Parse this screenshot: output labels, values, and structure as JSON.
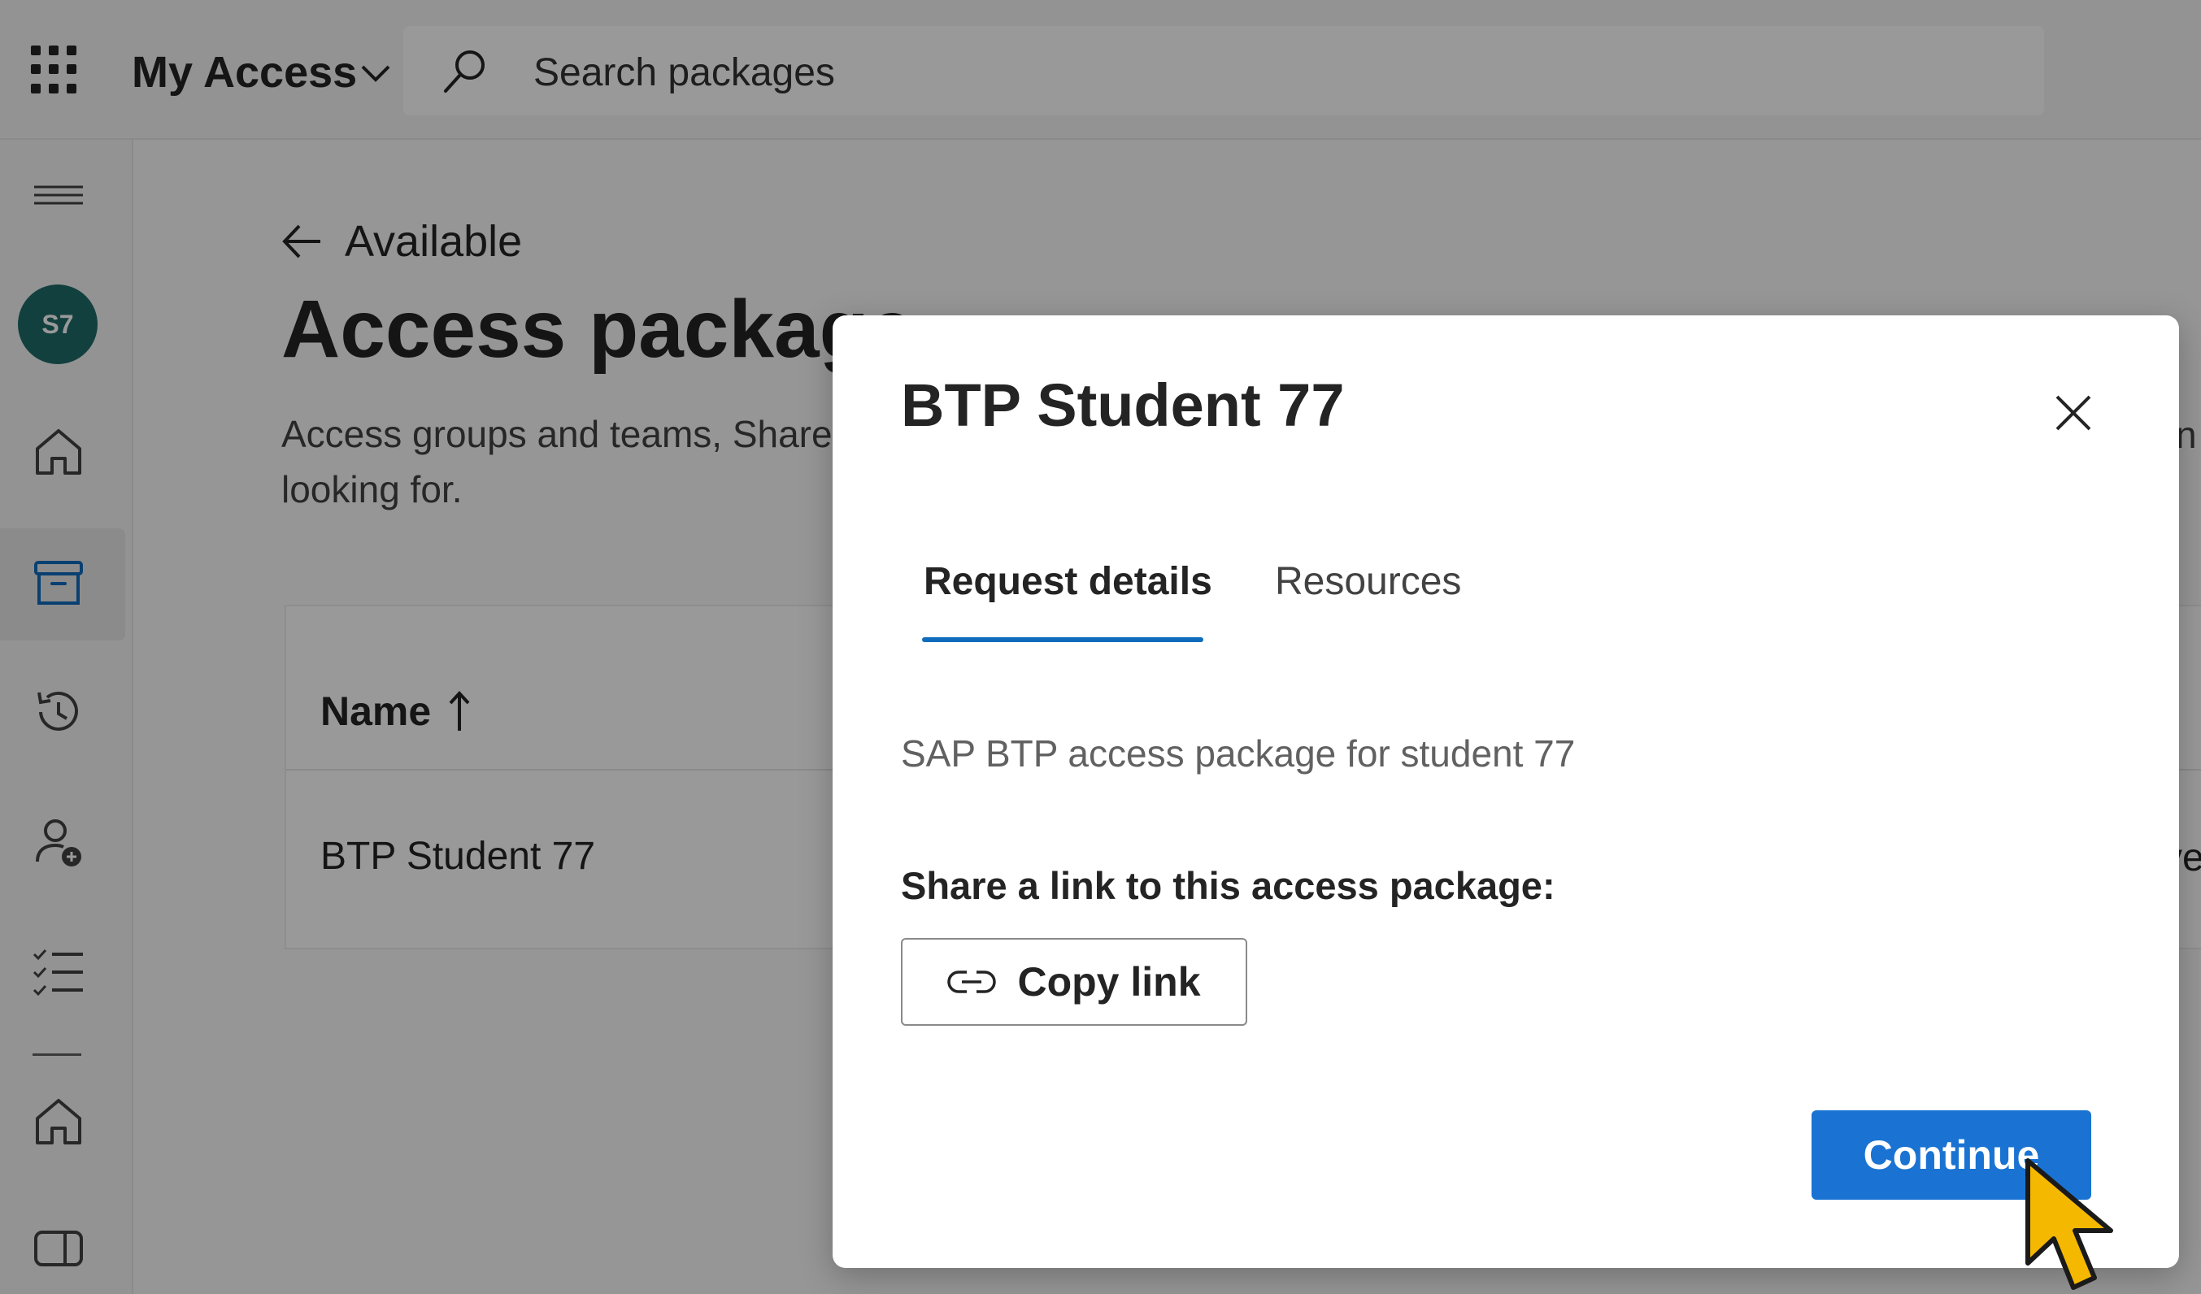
{
  "header": {
    "app_title": "My Access",
    "search_placeholder": "Search packages"
  },
  "sidebar": {
    "avatar_initials": "S7",
    "items": [
      {
        "icon": "home-icon"
      },
      {
        "icon": "archive-box-icon",
        "selected": true
      },
      {
        "icon": "history-icon"
      },
      {
        "icon": "person-add-icon"
      },
      {
        "icon": "task-list-icon"
      },
      {
        "icon": "home-icon"
      },
      {
        "icon": "panel-icon"
      }
    ]
  },
  "main": {
    "back_label": "Available",
    "title": "Access package",
    "description_line1": "Access groups and teams, Share",
    "description_line2": "looking for.",
    "description_cutoff_right": "n",
    "table": {
      "column_name": "Name",
      "rows": [
        {
          "name": "BTP Student 77",
          "cutoff_right": "ve"
        }
      ]
    }
  },
  "dialog": {
    "title": "BTP Student 77",
    "tabs": [
      {
        "label": "Request details",
        "active": true
      },
      {
        "label": "Resources",
        "active": false
      }
    ],
    "description": "SAP BTP access package for student 77",
    "share_label": "Share a link to this access package:",
    "copy_link_label": "Copy link",
    "continue_label": "Continue"
  },
  "colors": {
    "accent": "#0f6cbd",
    "primary_button": "#1a73d2",
    "avatar": "#1e6b68",
    "cursor": "#f5b800"
  }
}
